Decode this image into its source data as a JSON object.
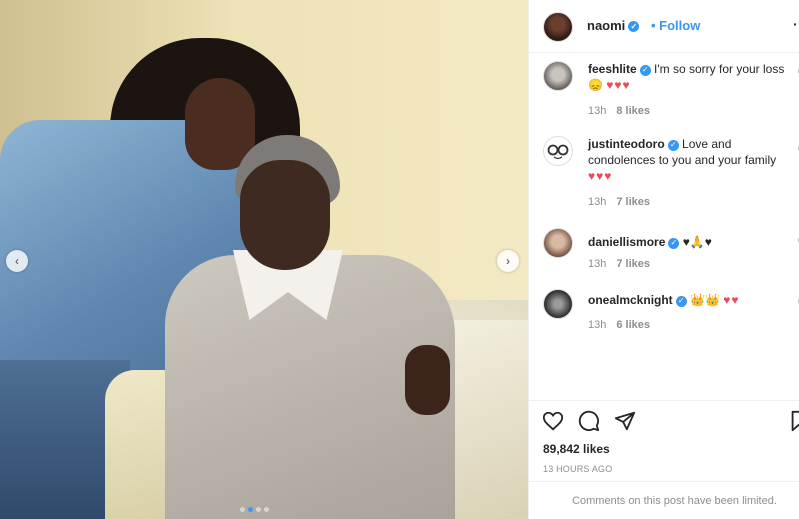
{
  "post": {
    "author": "naomi",
    "follow_label": "Follow",
    "more_label": "·",
    "carousel": {
      "slide_count": 4,
      "active_index": 1
    }
  },
  "comments": [
    {
      "user": "feeshlite",
      "text": "I'm so sorry for your loss 😞",
      "hearts": "♥♥♥",
      "time": "13h",
      "likes": "8 likes"
    },
    {
      "user": "justinteodoro",
      "text": "Love and condolences to you and your family",
      "hearts": "♥♥♥",
      "time": "13h",
      "likes": "7 likes"
    },
    {
      "user": "daniellismore",
      "text": "♥🙏♥",
      "hearts": "",
      "time": "13h",
      "likes": "7 likes"
    },
    {
      "user": "onealmcknight",
      "text": "👑👑",
      "hearts": "♥♥",
      "time": "13h",
      "likes": "6 likes"
    }
  ],
  "actions": {
    "likes_count": "89,842 likes",
    "time_ago": "13 HOURS AGO",
    "comments_limited": "Comments on this post have been limited."
  },
  "colors": {
    "accent": "#3897f0",
    "heart": "#ed4956",
    "muted": "#8e8e8e"
  },
  "icons": [
    "chevron-left-icon",
    "chevron-right-icon",
    "verified-icon",
    "heart-outline-icon",
    "comment-icon",
    "share-icon",
    "bookmark-icon",
    "plus-circle-icon"
  ]
}
